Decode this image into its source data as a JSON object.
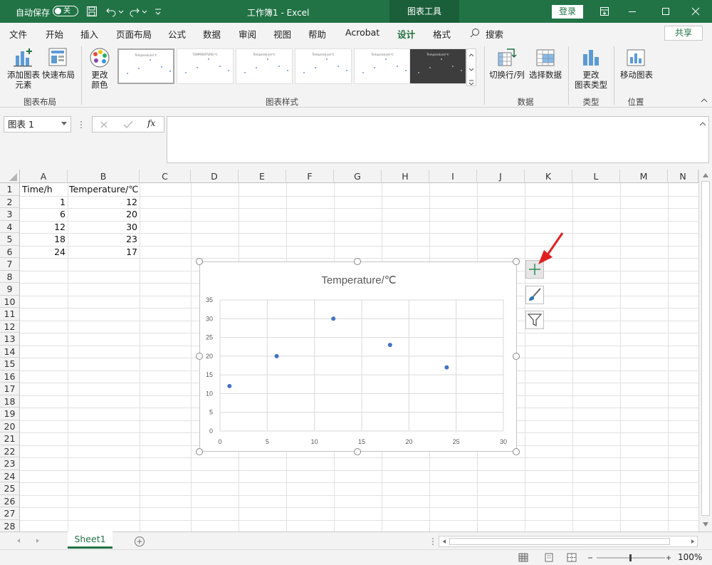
{
  "titlebar": {
    "autosave_label": "自动保存",
    "autosave_state": "关",
    "doc_title": "工作簿1  -  Excel",
    "context_tab": "图表工具",
    "login": "登录"
  },
  "menu": {
    "items": [
      "文件",
      "开始",
      "插入",
      "页面布局",
      "公式",
      "数据",
      "审阅",
      "视图",
      "帮助",
      "Acrobat",
      "设计",
      "格式"
    ],
    "active": "设计",
    "search": "搜索",
    "share": "共享"
  },
  "ribbon": {
    "add_element_1": "添加图表",
    "add_element_2": "元素",
    "quick_layout": "快速布局",
    "change_color_1": "更改",
    "change_color_2": "颜色",
    "switch_rowcol": "切换行/列",
    "select_data": "选择数据",
    "change_type_1": "更改",
    "change_type_2": "图表类型",
    "move_chart": "移动图表",
    "group_layout": "图表布局",
    "group_styles": "图表样式",
    "group_data": "数据",
    "group_type": "类型",
    "group_location": "位置",
    "style_thumbs": [
      "Temperature/℃",
      "TEMPERATURE/℃",
      "Temperature/℃",
      "Temperature/℃",
      "Temperature/℃",
      "Temperature/℃"
    ]
  },
  "formula": {
    "namebox": "图表 1",
    "fx": "fx",
    "content": ""
  },
  "columns": [
    "A",
    "B",
    "C",
    "D",
    "E",
    "F",
    "G",
    "H",
    "I",
    "J",
    "K",
    "L",
    "M",
    "N"
  ],
  "rows": [
    "1",
    "2",
    "3",
    "4",
    "5",
    "6",
    "7",
    "8",
    "9",
    "10",
    "11",
    "12",
    "13",
    "14",
    "15",
    "16",
    "17",
    "18",
    "19",
    "20",
    "21",
    "22",
    "23",
    "24",
    "25",
    "26",
    "27",
    "28"
  ],
  "cells": {
    "a1": "Time/h",
    "b1": "Temperature/℃",
    "a2": "1",
    "b2": "12",
    "a3": "6",
    "b3": "20",
    "a4": "12",
    "b4": "30",
    "a5": "18",
    "b5": "23",
    "a6": "24",
    "b6": "17"
  },
  "chart_data": {
    "type": "scatter",
    "title": "Temperature/℃",
    "xlabel": "",
    "ylabel": "",
    "x": [
      1,
      6,
      12,
      18,
      24
    ],
    "y": [
      12,
      20,
      30,
      23,
      17
    ],
    "xlim": [
      0,
      30
    ],
    "ylim": [
      0,
      35
    ],
    "xticks": [
      "0",
      "5",
      "10",
      "15",
      "20",
      "25",
      "30"
    ],
    "yticks": [
      "0",
      "5",
      "10",
      "15",
      "20",
      "25",
      "30",
      "35"
    ],
    "grid": true,
    "legend": "none",
    "color": "#4472c4"
  },
  "sheets": {
    "active": "Sheet1"
  },
  "status": {
    "zoom": "100%"
  },
  "colors": {
    "excel_green": "#217346",
    "point": "#4472c4"
  }
}
